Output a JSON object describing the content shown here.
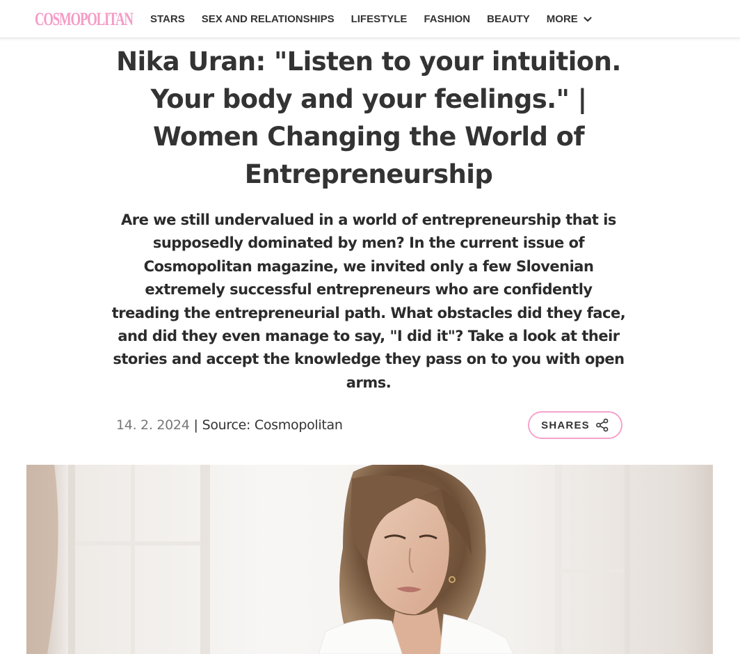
{
  "header": {
    "logo": "COSMOPOLITAN",
    "nav": [
      {
        "label": "STARS"
      },
      {
        "label": "SEX AND RELATIONSHIPS"
      },
      {
        "label": "LIFESTYLE"
      },
      {
        "label": "FASHION"
      },
      {
        "label": "BEAUTY"
      },
      {
        "label": "MORE",
        "icon": "chevron-down-icon"
      }
    ]
  },
  "article": {
    "title": "Nika Uran: \"Listen to your intuition. Your body and your feelings.\" | Women Changing the World of Entrepreneurship",
    "dek": "Are we still undervalued in a world of entrepreneurship that is supposedly dominated by men? In the current issue of Cosmopolitan magazine, we invited only a few Slovenian extremely successful entrepreneurs who are confidently treading the entrepreneurial path. What obstacles did they face, and did they even manage to say, \"I did it\"? Take a look at their stories and accept the knowledge they pass on to you with open arms.",
    "date": "14. 2. 2024",
    "separator": "|",
    "source": "Source: Cosmopolitan",
    "shares_label": "SHARES",
    "shares_icon": "share-icon"
  },
  "colors": {
    "brand_pink": "#f59bc6",
    "shares_border": "#f5a3cb",
    "text": "#333333"
  }
}
